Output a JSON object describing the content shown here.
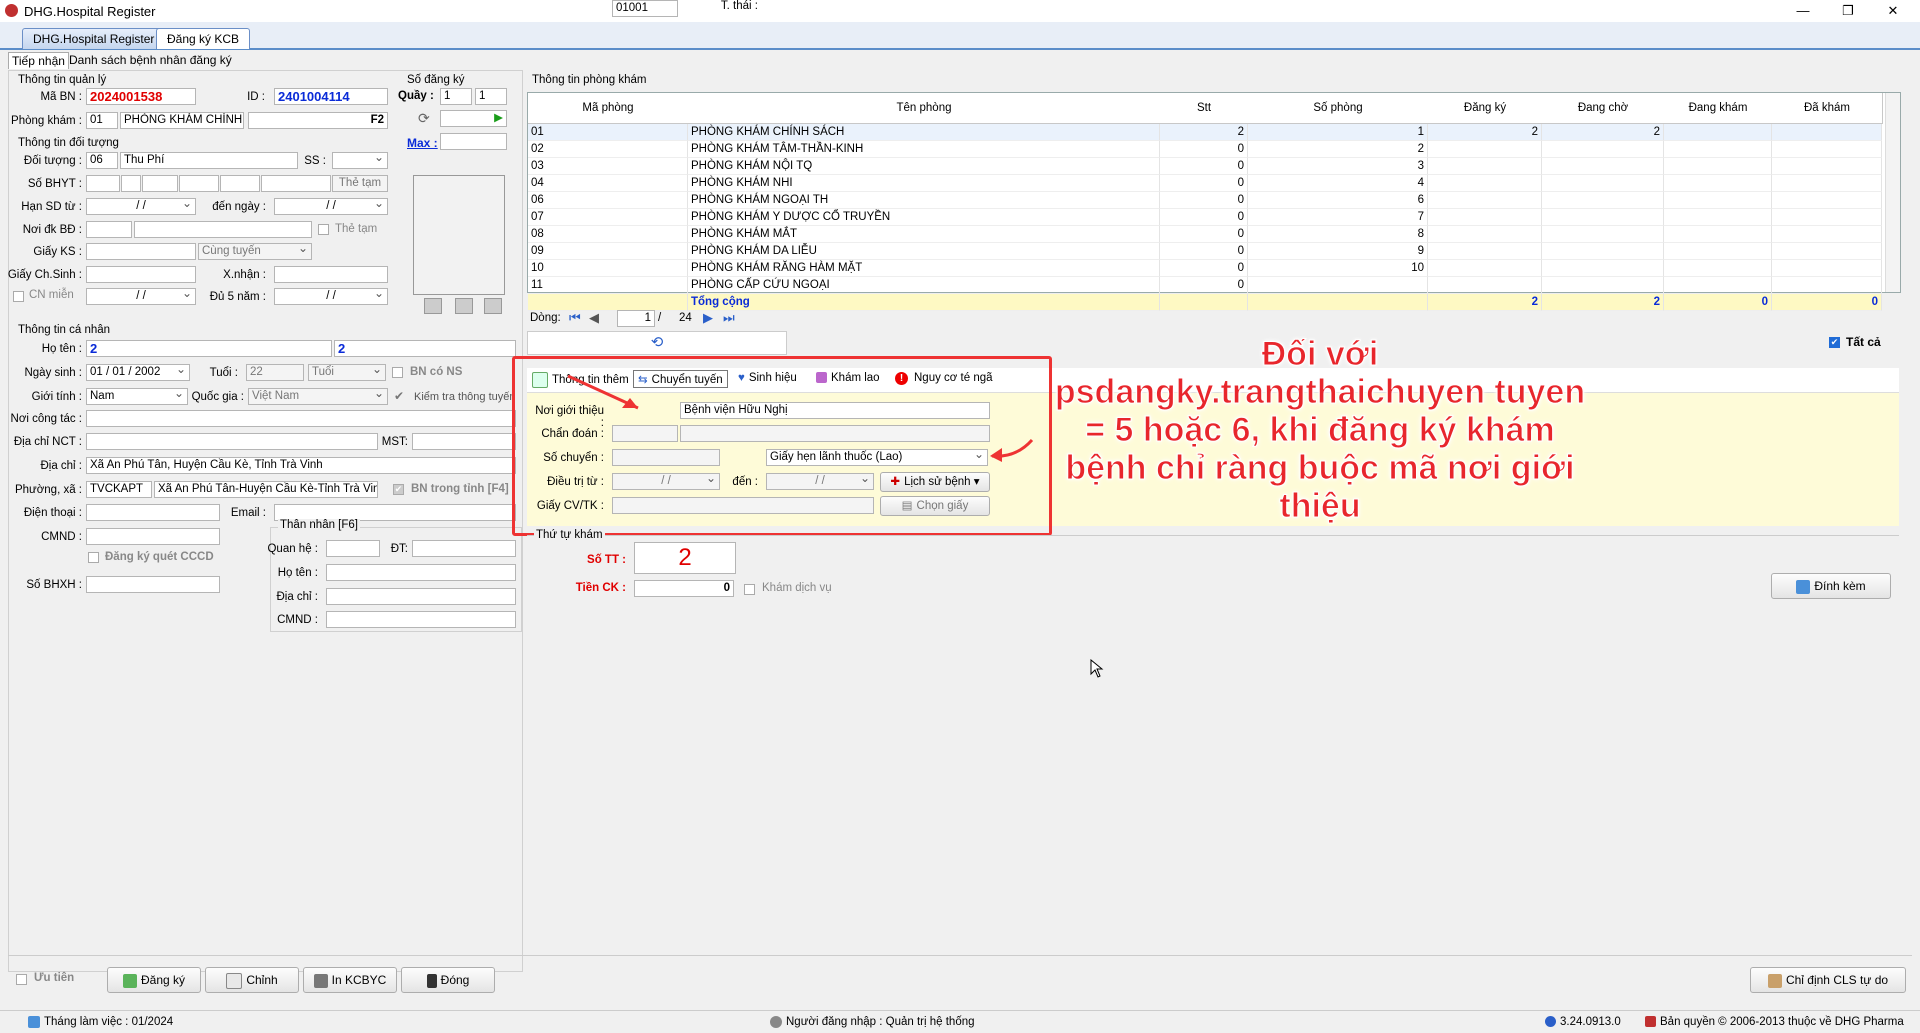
{
  "window": {
    "title": "DHG.Hospital Register"
  },
  "main_tabs": [
    {
      "label": "DHG.Hospital Register"
    },
    {
      "label": "Đăng ký KCB"
    }
  ],
  "sub_tabs": [
    {
      "label": "Tiếp nhận"
    },
    {
      "label": "Danh sách bệnh nhân đăng ký"
    }
  ],
  "quanly": {
    "group": "Thông tin quản lý",
    "mabn_label": "Mã BN :",
    "mabn": "2024001538",
    "id_label": "ID :",
    "id": "2401004114",
    "phongkham_label": "Phòng khám :",
    "phongkham_code": "01",
    "phongkham_name": "PHÒNG KHÁM CHÍNH S",
    "f2": "F2"
  },
  "sodangky": {
    "group": "Số đăng ký",
    "quay_label": "Quầy :",
    "quay1": "1",
    "quay2": "1",
    "max_label": "Max :"
  },
  "doituong": {
    "group": "Thông tin đối tượng",
    "doituong_label": "Đối tượng :",
    "doituong_code": "06",
    "doituong_name": "Thu Phí",
    "ss_label": "SS :",
    "sobhyt_label": "Số BHYT :",
    "the_tam_btn": "Thẻ tạm",
    "hansd_label": "Hạn SD từ :",
    "date_blank": "/ /",
    "denngay_label": "đến ngày :",
    "noidk_label": "Nơi đk BĐ :",
    "the_tam_chk": "Thẻ tạm",
    "giayks_label": "Giấy KS :",
    "cungtuyen": "Cùng tuyến",
    "giaychsinh_label": "Giấy Ch.Sinh :",
    "xnhan_label": "X.nhận :",
    "cnmien_label": "CN miễn",
    "du5nam_label": "Đủ 5 năm :"
  },
  "canhan": {
    "group": "Thông tin cá nhân",
    "hoten_label": "Họ tên :",
    "hoten1": "2",
    "hoten2": "2",
    "ngaysinh_label": "Ngày sinh :",
    "ngaysinh": "01 / 01 / 2002",
    "tuoi_label": "Tuổi :",
    "tuoi": "22",
    "tuoi_unit": "Tuổi",
    "bn_co_ns": "BN có NS",
    "gioitinh_label": "Giới tính :",
    "gioitinh": "Nam",
    "quocgia_label": "Quốc gia :",
    "quocgia": "Việt Nam",
    "kiemtra": "Kiểm tra thông tuyến",
    "noicongtac_label": "Nơi công tác :",
    "diachinct_label": "Địa chỉ NCT :",
    "mst_label": "MST:",
    "diachi_label": "Địa chỉ :",
    "diachi": "Xã An Phú Tân, Huyện Cầu Kè, Tỉnh Trà Vinh",
    "phuongxa_label": "Phường, xã :",
    "phuongxa_code": "TVCKAPT",
    "phuongxa_name": "Xã An Phú Tân-Huyện Cầu Kè-Tỉnh Trà Vinh",
    "bn_trong_tinh": "BN trong tỉnh [F4]",
    "dienthoai_label": "Điện thoại :",
    "email_label": "Email :",
    "cmnd_label": "CMND :",
    "dangky_cccd": "Đăng ký quét CCCD",
    "sobhxh_label": "Số BHXH :"
  },
  "thannhan": {
    "group": "Thân nhân [F6]",
    "quanhe_label": "Quan hệ :",
    "dt_label": "ĐT:",
    "hoten_label": "Họ tên :",
    "diachi_label": "Địa chỉ :",
    "cmnd_label": "CMND :"
  },
  "phongkham": {
    "group": "Thông tin phòng khám",
    "columns": [
      "Mã phòng",
      "Tên phòng",
      "Stt",
      "Số phòng",
      "Đăng ký",
      "Đang chờ",
      "Đang khám",
      "Đã khám"
    ],
    "rows": [
      [
        "01",
        "PHÒNG KHÁM CHÍNH SÁCH",
        "2",
        "1",
        "2",
        "2",
        "",
        ""
      ],
      [
        "02",
        "PHÒNG KHÁM TÂM-THẦN-KINH",
        "0",
        "2",
        "",
        "",
        "",
        ""
      ],
      [
        "03",
        "PHÒNG KHÁM NỘI TQ",
        "0",
        "3",
        "",
        "",
        "",
        ""
      ],
      [
        "04",
        "PHÒNG KHÁM NHI",
        "0",
        "4",
        "",
        "",
        "",
        ""
      ],
      [
        "06",
        "PHÒNG KHÁM NGOẠI TH",
        "0",
        "6",
        "",
        "",
        "",
        ""
      ],
      [
        "07",
        "PHÒNG KHÁM Y DƯỢC CỔ TRUYỀN",
        "0",
        "7",
        "",
        "",
        "",
        ""
      ],
      [
        "08",
        "PHÒNG KHÁM MẮT",
        "0",
        "8",
        "",
        "",
        "",
        ""
      ],
      [
        "09",
        "PHÒNG KHÁM DA LIỄU",
        "0",
        "9",
        "",
        "",
        "",
        ""
      ],
      [
        "10",
        "PHÒNG KHÁM RĂNG HÀM MẶT",
        "0",
        "10",
        "",
        "",
        "",
        ""
      ],
      [
        "11",
        "PHÒNG CẤP CỨU NGOẠI",
        "0",
        "",
        "",
        "",
        "",
        ""
      ]
    ],
    "total": {
      "label": "Tổng cộng",
      "dangky": "2",
      "dangcho": "2",
      "dangkham": "0",
      "dakham": "0"
    },
    "pager": {
      "label": "Dòng:",
      "page": "1",
      "sep": "/",
      "total": "24"
    },
    "tatca": "Tất cả"
  },
  "info_tabs": [
    {
      "label": "Thông tin thêm"
    },
    {
      "label": "Chuyển tuyến"
    },
    {
      "label": "Sinh hiệu"
    },
    {
      "label": "Khám lao"
    },
    {
      "label": "Nguy cơ té ngã"
    }
  ],
  "chuyentuyen": {
    "noigioithieu_label": "Nơi giới thiệu :",
    "noigioithieu_code": "01001",
    "noigioithieu_name": "Bệnh viện Hữu Nghị",
    "chandoan_label": "Chẩn đoán :",
    "sochuyen_label": "Số chuyển :",
    "tthai_label": "T. thái :",
    "tthai": "Giấy hẹn lãnh thuốc (Lao)",
    "dieutritu_label": "Điều trị từ :",
    "den_label": "đến :",
    "lichsubenh": "Lịch sử bệnh",
    "giaycv_label": "Giấy CV/TK :",
    "chongiay": "Chọn giấy"
  },
  "thutukham": {
    "group": "Thứ tự khám",
    "sott_label": "Số TT :",
    "sott": "2",
    "tienck_label": "Tiền CK :",
    "tienck": "0",
    "kham_dichvu": "Khám dịch vụ",
    "dinhkem": "Đính kèm"
  },
  "annotation": "Đối với psdangky.trangthaichuyen tuyen = 5 hoặc 6, khi đăng ký khám bệnh chỉ ràng buộc mã nơi giới thiệu",
  "bottom": {
    "uutien": "Ưu tiên",
    "dangky": "Đăng ký",
    "chinh": "Chỉnh",
    "inkcbyc": "In KCBYC",
    "dong": "Đóng",
    "chidinhcls": "Chỉ định CLS tự do"
  },
  "status": {
    "thang": "Tháng làm việc : 01/2024",
    "nguoidangnhap": "Người đăng nhập : Quản trị hệ thống",
    "version": "3.24.0913.0",
    "banquyen": "Bản quyền © 2006-2013 thuộc về DHG Pharma"
  },
  "colors": {
    "accent": "#1f6bd6",
    "red": "#e00000",
    "blue": "#0a2bd8",
    "highlight": "#fef9c3",
    "annotation": "#e8262c"
  }
}
